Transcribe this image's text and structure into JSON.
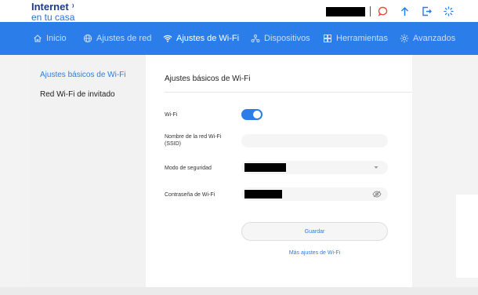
{
  "header": {
    "logo_line1": "Internet",
    "logo_line2": "en tu casa"
  },
  "nav": {
    "items": [
      {
        "label": "Inicio",
        "icon": "home-icon"
      },
      {
        "label": "Ajustes de red",
        "icon": "globe-icon"
      },
      {
        "label": "Ajustes de Wi-Fi",
        "icon": "wifi-icon"
      },
      {
        "label": "Dispositivos",
        "icon": "devices-icon"
      },
      {
        "label": "Herramientas",
        "icon": "tools-icon"
      },
      {
        "label": "Avanzados",
        "icon": "gear-icon"
      }
    ],
    "active_index": 2
  },
  "sidebar": {
    "items": [
      {
        "label": "Ajustes básicos de Wi-Fi",
        "active": true
      },
      {
        "label": "Red Wi-Fi de invitado",
        "active": false
      }
    ]
  },
  "content": {
    "title": "Ajustes básicos de Wi-Fi",
    "wifi_label": "Wi-Fi",
    "wifi_enabled": true,
    "ssid_label_line1": "Nombre de la red Wi-Fi",
    "ssid_label_line2": "(SSID)",
    "ssid_value": "",
    "security_label": "Modo de seguridad",
    "password_label": "Contraseña de Wi-Fi",
    "save_label": "Guardar",
    "more_label": "Más ajustes de Wi-Fi"
  },
  "colors": {
    "accent": "#2b7de9",
    "logo_dark": "#1a3a8a",
    "top_icon": "#2b7de9",
    "chat_icon": "#e24a3b"
  }
}
